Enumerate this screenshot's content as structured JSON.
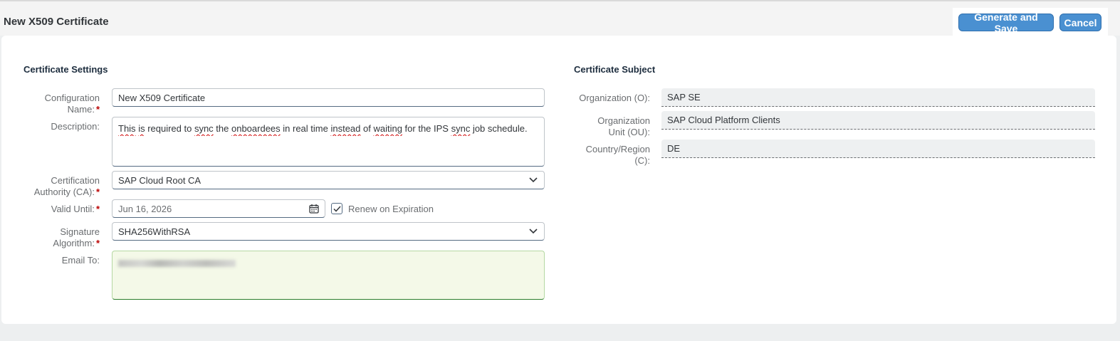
{
  "header": {
    "title": "New X509 Certificate",
    "generate_save_label": "Generate and Save",
    "cancel_label": "Cancel"
  },
  "settings": {
    "section_title": "Certificate Settings",
    "config_name_label": "Configuration Name:",
    "config_name_label_l1": "Configuration",
    "config_name_label_l2": "Name:",
    "config_name_value": "New X509 Certificate",
    "description_label": "Description:",
    "description_value": "This is required to sync the onboardees in real time instead of waiting for the IPS sync job schedule.",
    "ca_label_l1": "Certification",
    "ca_label_l2": "Authority (CA):",
    "ca_value": "SAP Cloud Root CA",
    "valid_until_label": "Valid Until:",
    "valid_until_value": "Jun 16, 2026",
    "renew_label": "Renew on Expiration",
    "renew_checked": true,
    "sig_label_l1": "Signature",
    "sig_label_l2": "Algorithm:",
    "sig_value": "SHA256WithRSA",
    "email_label": "Email To:"
  },
  "subject": {
    "section_title": "Certificate Subject",
    "org_label": "Organization (O):",
    "org_value": "SAP SE",
    "ou_label_l1": "Organization",
    "ou_label_l2": "Unit (OU):",
    "ou_value": "SAP Cloud Platform Clients",
    "country_label_l1": "Country/Region",
    "country_label_l2": "(C):",
    "country_value": "DE"
  },
  "icons": {
    "calendar": "calendar-icon",
    "chevron": "chevron-down-icon",
    "check": "checkmark-icon"
  },
  "colors": {
    "accent": "#4a90d1",
    "required": "#bb0000",
    "email_bg": "#f4f9e8"
  }
}
